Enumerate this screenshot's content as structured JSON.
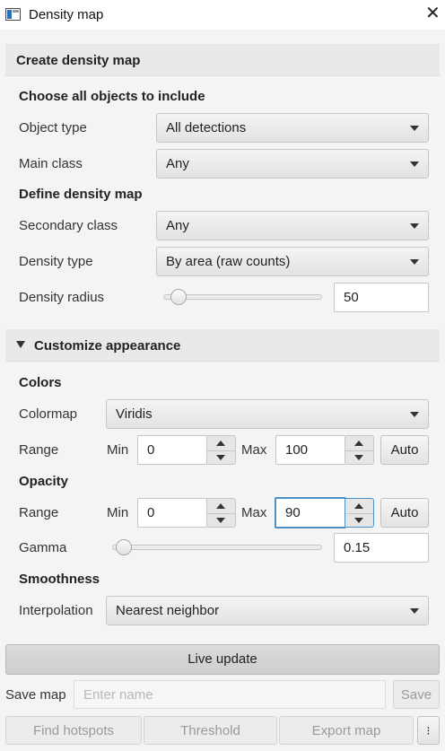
{
  "window": {
    "title": "Density map",
    "close_icon": "close-icon"
  },
  "create": {
    "section_title": "Create density map",
    "include_heading": "Choose all objects to include",
    "object_type_label": "Object type",
    "object_type_value": "All detections",
    "main_class_label": "Main class",
    "main_class_value": "Any",
    "define_heading": "Define density map",
    "secondary_class_label": "Secondary class",
    "secondary_class_value": "Any",
    "density_type_label": "Density type",
    "density_type_value": "By area (raw counts)",
    "density_radius_label": "Density radius",
    "density_radius_value": "50",
    "density_radius_fraction": 0.05
  },
  "appearance": {
    "section_title": "Customize appearance",
    "expanded": true,
    "colors_heading": "Colors",
    "colormap_label": "Colormap",
    "colormap_value": "Viridis",
    "color_range": {
      "label": "Range",
      "min_label": "Min",
      "min_value": "0",
      "max_label": "Max",
      "max_value": "100",
      "auto_label": "Auto"
    },
    "opacity_heading": "Opacity",
    "opacity_range": {
      "label": "Range",
      "min_label": "Min",
      "min_value": "0",
      "max_label": "Max",
      "max_value": "90",
      "auto_label": "Auto"
    },
    "gamma_label": "Gamma",
    "gamma_value": "0.15",
    "gamma_fraction": 0.02,
    "smoothness_heading": "Smoothness",
    "interpolation_label": "Interpolation",
    "interpolation_value": "Nearest neighbor"
  },
  "footer": {
    "live_update_label": "Live update",
    "save_map_label": "Save map",
    "name_placeholder": "Enter name",
    "save_label": "Save",
    "find_hotspots_label": "Find hotspots",
    "threshold_label": "Threshold",
    "export_map_label": "Export map",
    "more_label": "⁝"
  },
  "colors": {
    "focus_border": "#4a90c8",
    "accent_blue": "#2f6fb5"
  }
}
